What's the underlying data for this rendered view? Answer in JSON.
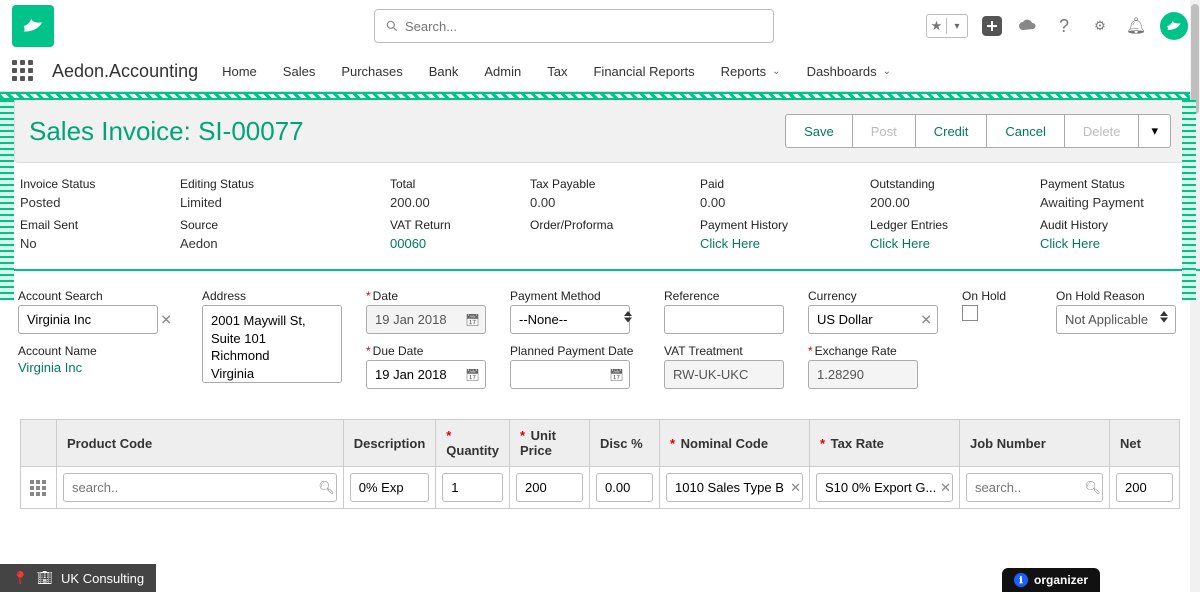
{
  "header": {
    "search_placeholder": "Search..."
  },
  "nav": {
    "app_name": "Aedon.Accounting",
    "items": [
      "Home",
      "Sales",
      "Purchases",
      "Bank",
      "Admin",
      "Tax",
      "Financial Reports",
      "Reports",
      "Dashboards"
    ]
  },
  "page": {
    "title": "Sales Invoice: SI-00077",
    "actions": {
      "save": "Save",
      "post": "Post",
      "credit": "Credit",
      "cancel": "Cancel",
      "delete": "Delete"
    }
  },
  "status": {
    "invoice_status": {
      "label": "Invoice Status",
      "value": "Posted"
    },
    "editing_status": {
      "label": "Editing Status",
      "value": "Limited"
    },
    "total": {
      "label": "Total",
      "value": "200.00"
    },
    "tax_payable": {
      "label": "Tax Payable",
      "value": "0.00"
    },
    "paid": {
      "label": "Paid",
      "value": "0.00"
    },
    "outstanding": {
      "label": "Outstanding",
      "value": "200.00"
    },
    "payment_status": {
      "label": "Payment Status",
      "value": "Awaiting Payment"
    },
    "email_sent": {
      "label": "Email Sent",
      "value": "No"
    },
    "source": {
      "label": "Source",
      "value": "Aedon"
    },
    "vat_return": {
      "label": "VAT Return",
      "value": "00060",
      "link": true
    },
    "order_proforma": {
      "label": "Order/Proforma",
      "value": ""
    },
    "payment_history": {
      "label": "Payment History",
      "value": "Click Here",
      "link": true
    },
    "ledger_entries": {
      "label": "Ledger Entries",
      "value": "Click Here",
      "link": true
    },
    "audit_history": {
      "label": "Audit History",
      "value": "Click Here",
      "link": true
    }
  },
  "form": {
    "account_search": {
      "label": "Account Search",
      "value": "Virginia Inc"
    },
    "account_name": {
      "label": "Account Name",
      "value": "Virginia Inc"
    },
    "address": {
      "label": "Address",
      "value": "2001 Maywill St, Suite 101\nRichmond\nVirginia"
    },
    "date": {
      "label": "Date",
      "value": "19 Jan 2018"
    },
    "due_date": {
      "label": "Due Date",
      "value": "19 Jan 2018"
    },
    "payment_method": {
      "label": "Payment Method",
      "value": "--None--"
    },
    "planned_payment_date": {
      "label": "Planned Payment Date",
      "value": ""
    },
    "reference": {
      "label": "Reference",
      "value": ""
    },
    "vat_treatment": {
      "label": "VAT Treatment",
      "value": "RW-UK-UKC"
    },
    "currency": {
      "label": "Currency",
      "value": "US Dollar"
    },
    "exchange_rate": {
      "label": "Exchange Rate",
      "value": "1.28290"
    },
    "on_hold": {
      "label": "On Hold"
    },
    "on_hold_reason": {
      "label": "On Hold Reason",
      "value": "Not Applicable"
    }
  },
  "lines": {
    "cols": {
      "product": "Product Code",
      "description": "Description",
      "quantity": "Quantity",
      "unit_price": "Unit Price",
      "disc": "Disc %",
      "nominal": "Nominal Code",
      "tax_rate": "Tax Rate",
      "job": "Job Number",
      "net": "Net"
    },
    "row": {
      "product_placeholder": "search..",
      "description": "0% Exp",
      "quantity": "1",
      "unit_price": "200",
      "disc": "0.00",
      "nominal": "1010 Sales Type B",
      "tax_rate": "S10 0% Export G...",
      "job_placeholder": "search..",
      "net": "200"
    }
  },
  "footer": {
    "left": "UK Consulting",
    "right": "organizer"
  }
}
